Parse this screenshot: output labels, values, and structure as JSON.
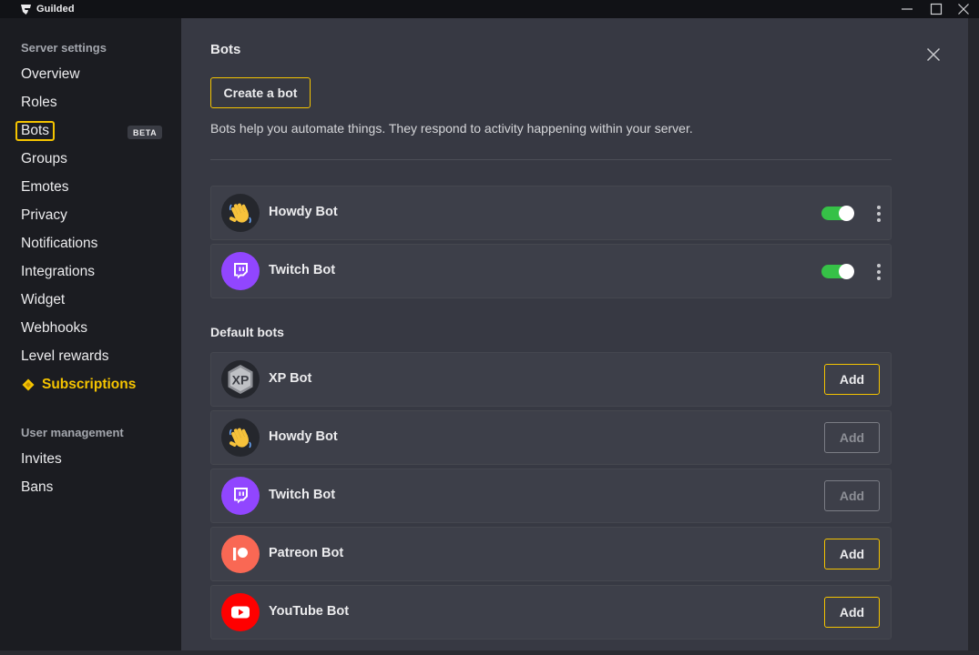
{
  "app": {
    "name": "Guilded"
  },
  "sidebar": {
    "server_heading": "Server settings",
    "items": [
      {
        "label": "Overview"
      },
      {
        "label": "Roles"
      },
      {
        "label": "Bots",
        "badge": "BETA"
      },
      {
        "label": "Groups"
      },
      {
        "label": "Emotes"
      },
      {
        "label": "Privacy"
      },
      {
        "label": "Notifications"
      },
      {
        "label": "Integrations"
      },
      {
        "label": "Widget"
      },
      {
        "label": "Webhooks"
      },
      {
        "label": "Level rewards"
      },
      {
        "label": "Subscriptions"
      }
    ],
    "user_heading": "User management",
    "user_items": [
      {
        "label": "Invites"
      },
      {
        "label": "Bans"
      }
    ]
  },
  "main": {
    "title": "Bots",
    "create_button": "Create a bot",
    "description": "Bots help you automate things. They respond to activity happening within your server.",
    "installed_bots": [
      {
        "name": "Howdy Bot",
        "icon": "waving-hand-icon",
        "enabled": true
      },
      {
        "name": "Twitch Bot",
        "icon": "twitch-icon",
        "enabled": true
      }
    ],
    "default_heading": "Default bots",
    "default_bots": [
      {
        "name": "XP Bot",
        "icon": "xp-icon",
        "action": "Add",
        "add_enabled": true
      },
      {
        "name": "Howdy Bot",
        "icon": "waving-hand-icon",
        "action": "Add",
        "add_enabled": false
      },
      {
        "name": "Twitch Bot",
        "icon": "twitch-icon",
        "action": "Add",
        "add_enabled": false
      },
      {
        "name": "Patreon Bot",
        "icon": "patreon-icon",
        "action": "Add",
        "add_enabled": true
      },
      {
        "name": "YouTube Bot",
        "icon": "youtube-icon",
        "action": "Add",
        "add_enabled": true
      }
    ]
  },
  "colors": {
    "accent": "#f5c400",
    "toggle_on": "#36c147",
    "twitch": "#9146ff",
    "patreon": "#f96854",
    "youtube": "#ff0000"
  }
}
